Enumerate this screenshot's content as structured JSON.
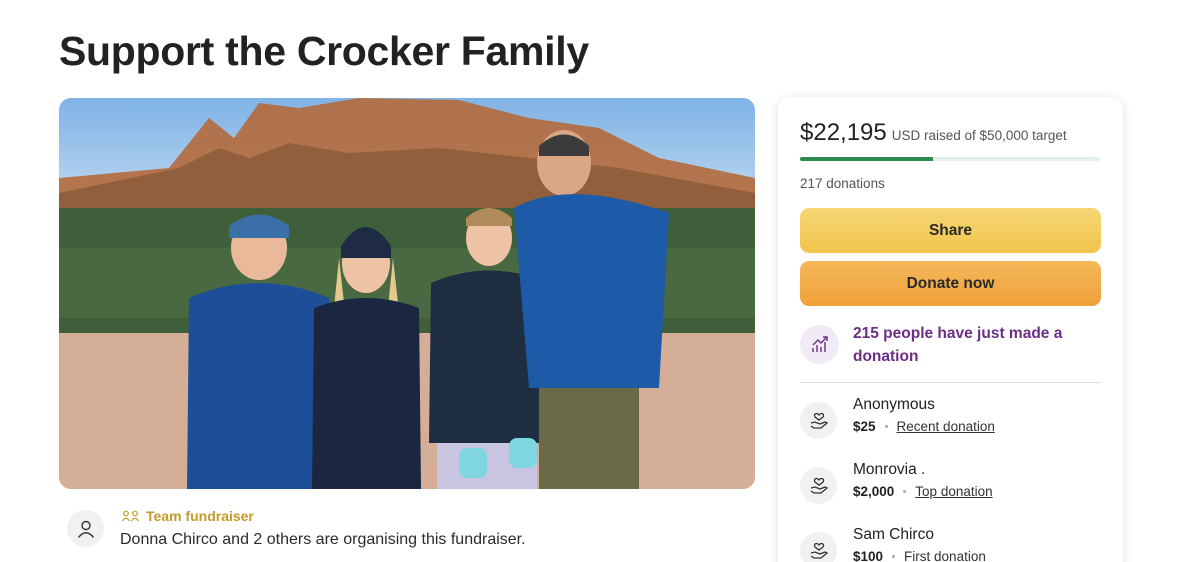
{
  "page": {
    "title": "Support the Crocker Family"
  },
  "organiser": {
    "team_label": "Team fundraiser",
    "text": "Donna Chirco and 2 others are organising this fundraiser."
  },
  "donation_card": {
    "raised_amount": "$22,195",
    "raised_text": "USD raised of $50,000 target",
    "progress_fraction": 0.444,
    "donations_count": "217 donations",
    "share_label": "Share",
    "donate_label": "Donate now",
    "trending_text": "215 people have just made a donation",
    "donors": [
      {
        "name": "Anonymous",
        "amount": "$25",
        "tag": "Recent donation"
      },
      {
        "name": "Monrovia .",
        "amount": "$2,000",
        "tag": "Top donation"
      },
      {
        "name": "Sam Chirco",
        "amount": "$100",
        "tag": "First donation"
      }
    ]
  },
  "colors": {
    "progress": "#2e8a4f",
    "share": "#f1c44c",
    "donate": "#efa13a",
    "trending": "#6b2e86",
    "team": "#c49a2a"
  }
}
